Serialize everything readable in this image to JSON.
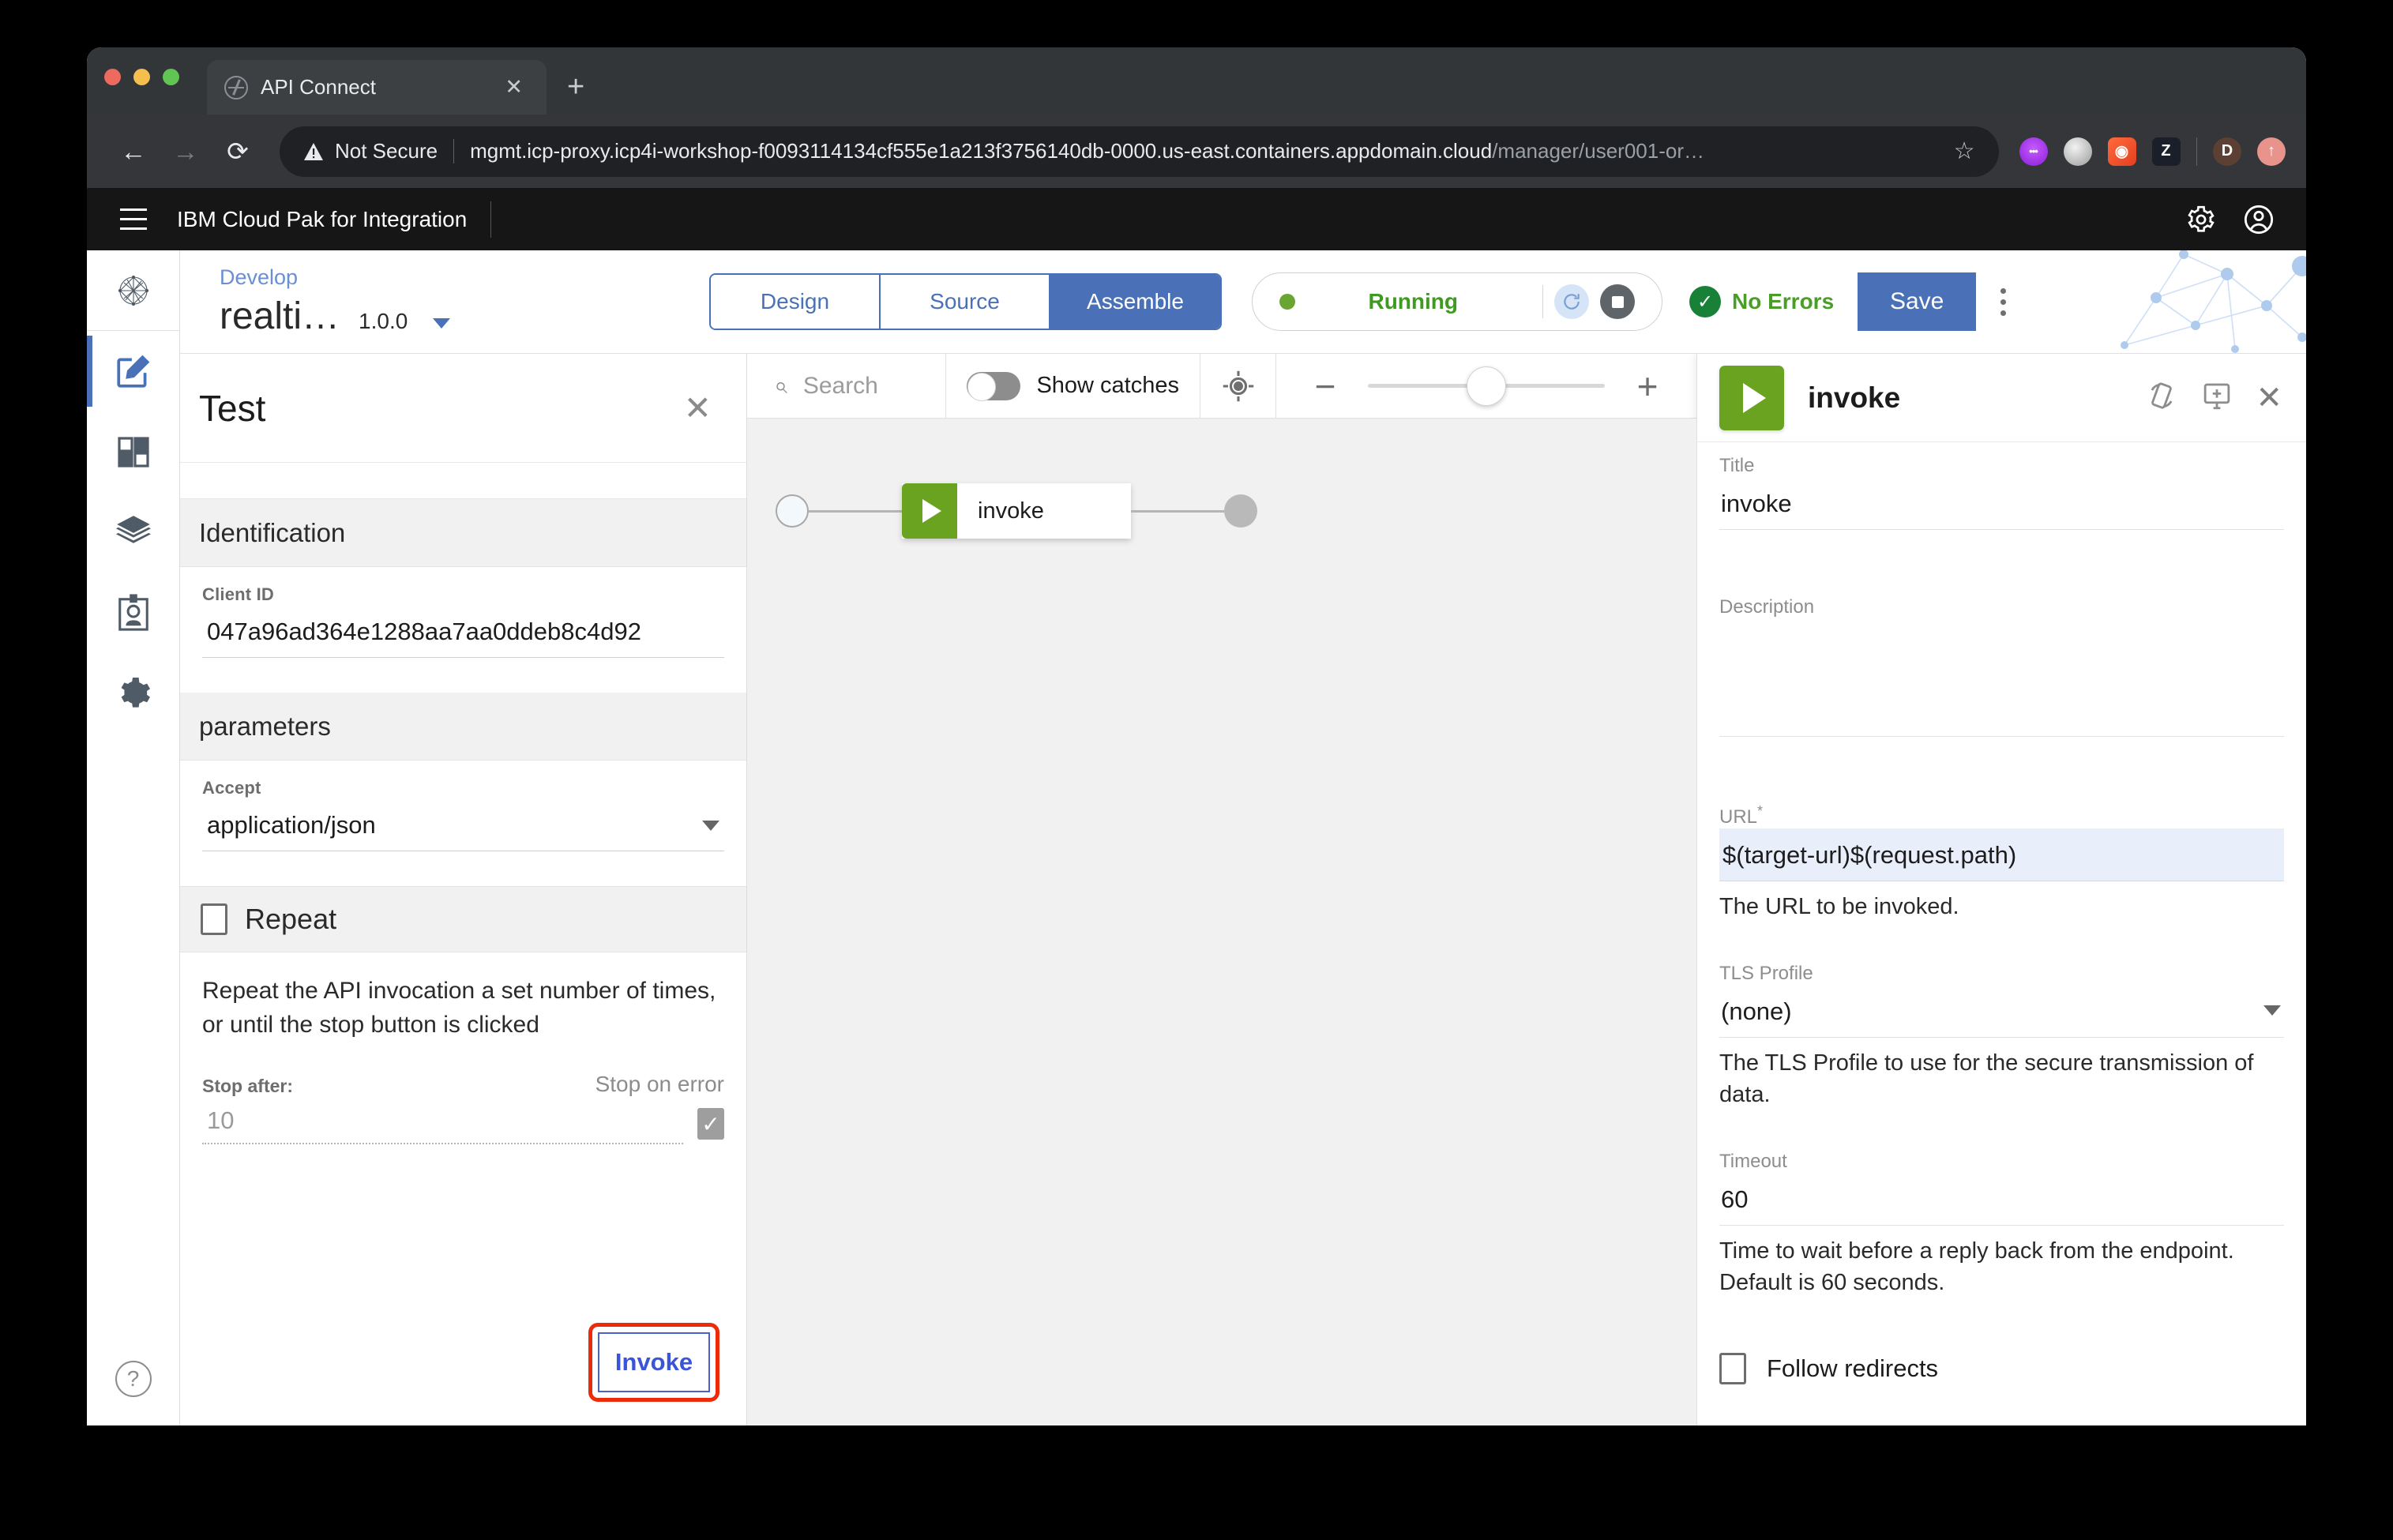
{
  "browser": {
    "tab_title": "API Connect",
    "tab_close": "✕",
    "new_tab": "+",
    "back": "←",
    "forward": "→",
    "reload": "⟳",
    "security_label": "Not Secure",
    "url_main": "mgmt.icp-proxy.icp4i-workshop-f0093114134cf555e1a213f3756140db-0000.us-east.containers.appdomain.cloud",
    "url_path": "/manager/user001-or…",
    "bookmark_star": "☆",
    "extension_z": "Z",
    "extension_d": "D",
    "extension_up": "↑"
  },
  "ibm_header": {
    "title": "IBM Cloud Pak for Integration",
    "settings_icon": "gear-icon",
    "account_icon": "user-avatar-icon"
  },
  "rail": {
    "items": [
      {
        "name": "home-graph-icon",
        "label": "Home"
      },
      {
        "name": "develop-icon",
        "label": "Develop",
        "active": true
      },
      {
        "name": "catalog-icon",
        "label": "Manage"
      },
      {
        "name": "layers-icon",
        "label": "Products"
      },
      {
        "name": "identity-icon",
        "label": "Members"
      },
      {
        "name": "settings-gear-icon",
        "label": "Settings"
      }
    ],
    "help_label": "?"
  },
  "api_header": {
    "breadcrumb": "Develop",
    "api_name": "realti…",
    "api_version": "1.0.0",
    "tabs": [
      {
        "label": "Design",
        "active": false
      },
      {
        "label": "Source",
        "active": false
      },
      {
        "label": "Assemble",
        "active": true
      }
    ],
    "status_text": "Running",
    "refresh_icon": "refresh-icon",
    "stop_icon": "stop-icon",
    "errors_text": "No Errors",
    "errors_check": "✓",
    "save_label": "Save",
    "overflow_icon": "kebab-menu-icon"
  },
  "test_panel": {
    "title": "Test",
    "close": "✕",
    "sections": [
      {
        "heading": "Identification"
      },
      {
        "heading": "parameters"
      }
    ],
    "client_id_label": "Client ID",
    "client_id_value": "047a96ad364e1288aa7aa0ddeb8c4d92",
    "accept_label": "Accept",
    "accept_value": "application/json",
    "repeat_label": "Repeat",
    "repeat_checked": false,
    "repeat_description": "Repeat the API invocation a set number of times, or until the stop button is clicked",
    "stop_after_label": "Stop after:",
    "stop_after_value": "10",
    "stop_on_error_label": "Stop on error",
    "stop_on_error_checked": true,
    "stop_on_error_check": "✓",
    "invoke_label": "Invoke",
    "invoke_highlight_color": "#ec2b0b"
  },
  "canvas_toolbar": {
    "search_placeholder": "Search",
    "search_icon": "search-icon",
    "show_catches_label": "Show catches",
    "show_catches_on": false,
    "target_icon": "center-target-icon",
    "zoom_minus": "−",
    "zoom_plus": "+",
    "zoom_percent": 50
  },
  "flow": {
    "start_node": "start-circle",
    "node_label": "invoke",
    "node_color": "#6aa320",
    "end_node": "end-circle"
  },
  "props": {
    "header_title": "invoke",
    "rotate_icon": "toggle-orientation-icon",
    "add_panel_icon": "add-to-screen-icon",
    "close": "✕",
    "title_label": "Title",
    "title_value": "invoke",
    "description_label": "Description",
    "description_value": "",
    "url_label": "URL",
    "url_required": "*",
    "url_value": "$(target-url)$(request.path)",
    "url_help": "The URL to be invoked.",
    "tls_label": "TLS Profile",
    "tls_value": "(none)",
    "tls_help": "The TLS Profile to use for the secure transmission of data.",
    "timeout_label": "Timeout",
    "timeout_value": "60",
    "timeout_help": "Time to wait before a reply back from the endpoint. Default is 60 seconds.",
    "follow_redirects_label": "Follow redirects",
    "follow_redirects_checked": false
  }
}
